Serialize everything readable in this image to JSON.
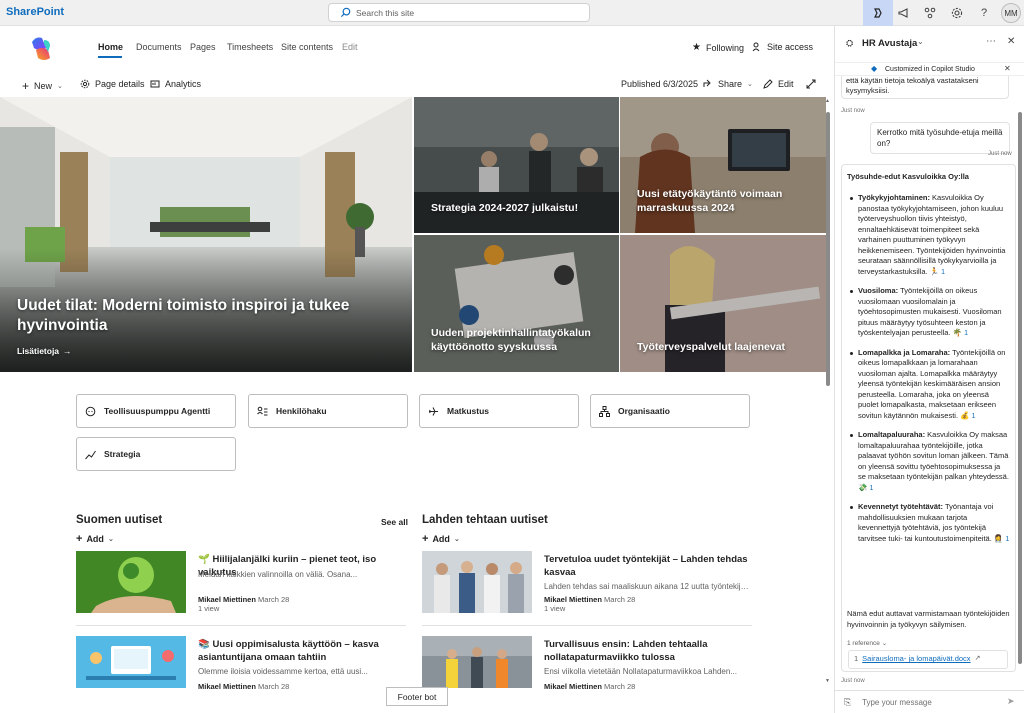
{
  "suitebar": {
    "brand": "SharePoint",
    "search_placeholder": "Search this site",
    "avatar_initials": "MM"
  },
  "nav": {
    "items": [
      "Home",
      "Documents",
      "Pages",
      "Timesheets",
      "Site contents",
      "Edit"
    ],
    "following": "Following",
    "site_access": "Site access"
  },
  "commandbar": {
    "new": "New",
    "page_details": "Page details",
    "analytics": "Analytics",
    "published": "Published 6/3/2025",
    "share": "Share",
    "edit": "Edit"
  },
  "hero": {
    "main_title": "Uudet tilat: Moderni toimisto inspiroi ja tukee hyvinvointia",
    "main_link": "Lisätietoja",
    "tile1": "Strategia 2024-2027 julkaistu!",
    "tile2": "Uusi etätyökäytäntö voimaan marraskuussa 2024",
    "tile3": "Uuden projektinhallintatyökalun käyttöönotto syyskuussa",
    "tile4": "Työterveyspalvelut laajenevat"
  },
  "quicklinks": [
    "Teollisuuspumppu Agentti",
    "Henkilöhaku",
    "Matkustus",
    "Organisaatio",
    "Strategia"
  ],
  "news_left": {
    "title": "Suomen uutiset",
    "see_all": "See all",
    "add": "Add",
    "items": [
      {
        "emoji": "🌱",
        "title": "Hiilijalanjälki kuriin – pienet teot, iso vaikutus",
        "desc": "Meidän kaikkien valinnoilla on väliä. Osana...",
        "author": "Mikael Miettinen",
        "date": "March 28",
        "views": "1 view"
      },
      {
        "emoji": "📚",
        "title": "Uusi oppimisalusta käyttöön – kasva asiantuntijana omaan tahtiin",
        "desc": "Olemme iloisia voidessamme kertoa, että uusi...",
        "author": "Mikael Miettinen",
        "date": "March 28",
        "views": ""
      }
    ]
  },
  "news_right": {
    "title": "Lahden tehtaan uutiset",
    "add": "Add",
    "items": [
      {
        "title": "Tervetuloa uudet työntekijät – Lahden tehdas kasvaa",
        "desc": "Lahden tehdas sai maaliskuun aikana 12 uutta työntekijä...",
        "author": "Mikael Miettinen",
        "date": "March 28",
        "views": "1 view"
      },
      {
        "title": "Turvallisuus ensin: Lahden tehtaalla nollatapaturmaviikko tulossa",
        "desc": "Ensi viikolla vietetään Nollatapaturmaviikkoa Lahden...",
        "author": "Mikael Miettinen",
        "date": "March 28",
        "views": ""
      }
    ]
  },
  "footer_bot": "Footer bot",
  "copilot": {
    "title": "HR Avustaja",
    "banner": "Customized in Copilot Studio",
    "prev_text": "että käytän tietoja tekoälyä vastatakseni kysymyksiisi.",
    "just_now": "Just now",
    "user_msg": "Kerrotko mitä työsuhde-etuja meillä on?",
    "resp_title": "Työsuhde-edut Kasvuloikka Oy:lla",
    "bullets": [
      {
        "head": "Työkykyjohtaminen:",
        "text": " Kasvuloikka Oy panostaa työkykyjohtamiseen, johon kuuluu työterveyshuollon tiivis yhteistyö, ennaltaehkäisevät toimenpiteet sekä varhainen puuttuminen työkyvyn heikkenemiseen. Työntekijöiden hyvinvointia seurataan säännöllisillä työkykyarvioilla ja terveystarkastuksilla. 🏃"
      },
      {
        "head": "Vuosiloma:",
        "text": " Työntekijöillä on oikeus vuosilomaan vuosilomalain ja työehtosopimusten mukaisesti. Vuosiloman pituus määräytyy työsuhteen keston ja työskentelyajan perusteella. 🌴"
      },
      {
        "head": "Lomapalkka ja Lomaraha:",
        "text": " Työntekijöillä on oikeus lomapalkkaan ja lomarahaan vuosiloman ajalta. Lomapalkka määräytyy yleensä työntekijän keskimääräisen ansion perusteella. Lomaraha, joka on yleensä puolet lomapalkasta, maksetaan erikseen sovitun käytännön mukaisesti. 💰"
      },
      {
        "head": "Lomaltapaluuraha:",
        "text": " Kasvuloikka Oy maksaa lomaltapaluurahaa työntekijöille, jotka palaavat työhön sovitun loman jälkeen. Tämä on yleensä sovittu työehtosopimuksessa ja se maksetaan työntekijän palkan yhteydessä. 💸"
      },
      {
        "head": "Kevennetyt työtehtävät:",
        "text": " Työnantaja voi mahdollisuuksien mukaan tarjota kevennettyjä työtehtäviä, jos työntekijä tarvitsee tuki- tai kuntoutustoimenpiteitä. 👩‍⚕️"
      }
    ],
    "cite": "1",
    "closing": "Nämä edut auttavat varmistamaan työntekijöiden hyvinvoinnin ja työkyvyn säilymisen.",
    "ref_count": "1 reference",
    "ref_num": "1",
    "ref_file": "Sairausloma- ja lomapäivät.docx",
    "input_placeholder": "Type your message"
  },
  "colors": {
    "accent": "#0f6cbd",
    "suitebar": "#f0f0f0"
  }
}
